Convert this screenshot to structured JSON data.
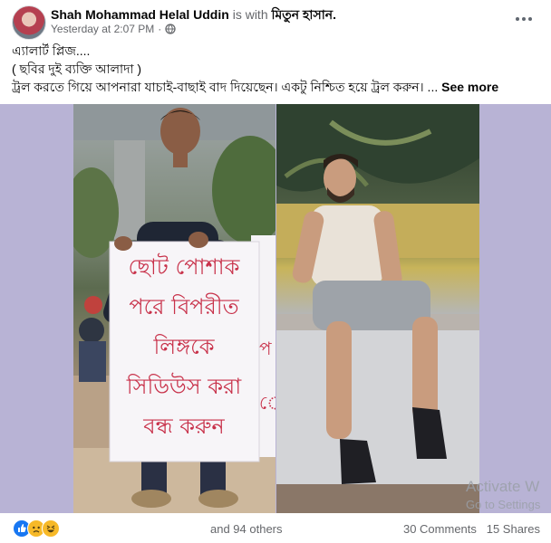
{
  "post": {
    "author": "Shah Mohammad Helal Uddin",
    "with_text": "is with",
    "tagged": "মিতুন হাসান.",
    "timestamp": "Yesterday at 2:07 PM",
    "privacy_icon": "globe-icon",
    "text_lines": [
      "এ্যালার্ট প্লিজ....",
      "( ছবির দুই ব্যক্তি আলাদা )",
      "ট্রল করতে গিয়ে আপনারা যাচাই-বাছাই বাদ দিয়েছেন।   একটু নিশ্চিত হয়ে ট্রল করুন। ..."
    ],
    "see_more": "See more"
  },
  "photo": {
    "sign_lines": [
      "ছোট পোশাক",
      "পরে বিপরীত",
      "লিঙ্গকে",
      "সিডিউস করা",
      "বন্ধ করুন"
    ],
    "sign_fragments": [
      "প",
      "প",
      "ে"
    ]
  },
  "footer": {
    "reactions": [
      "like-icon",
      "sad-icon",
      "haha-icon"
    ],
    "others": "and 94 others",
    "comments": "30 Comments",
    "shares": "15 Shares"
  },
  "watermark": {
    "line1": "Activate W",
    "line2": "Go to Settings"
  },
  "colors": {
    "background": "#b8b3d5",
    "sign_text": "#c8314a",
    "like": "#1877f2",
    "sad": "#f7b928",
    "haha": "#f7b928"
  }
}
